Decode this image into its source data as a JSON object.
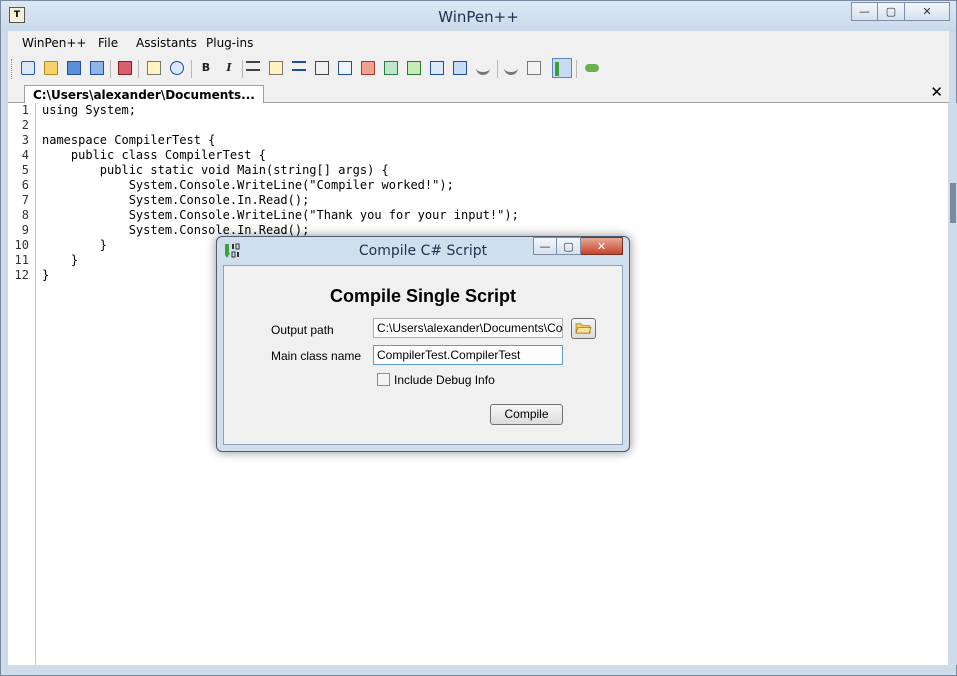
{
  "window": {
    "title": "WinPen++",
    "icon_label": "T"
  },
  "menu": {
    "items": [
      {
        "label": "WinPen++"
      },
      {
        "label": "File"
      },
      {
        "label": "Assistants"
      },
      {
        "label": "Plug-ins"
      }
    ]
  },
  "toolbar": {
    "bold_label": "B",
    "italic_label": "I"
  },
  "tabs": {
    "active_label": "C:\\Users\\alexander\\Documents...",
    "close_label": "✕"
  },
  "editor": {
    "lines": [
      {
        "num": "1",
        "text": "using System;"
      },
      {
        "num": "2",
        "text": ""
      },
      {
        "num": "3",
        "text": "namespace CompilerTest {"
      },
      {
        "num": "4",
        "text": "    public class CompilerTest {"
      },
      {
        "num": "5",
        "text": "        public static void Main(string[] args) {"
      },
      {
        "num": "6",
        "text": "            System.Console.WriteLine(\"Compiler worked!\");"
      },
      {
        "num": "7",
        "text": "            System.Console.In.Read();"
      },
      {
        "num": "8",
        "text": "            System.Console.WriteLine(\"Thank you for your input!\");"
      },
      {
        "num": "9",
        "text": "            System.Console.In.Read();"
      },
      {
        "num": "10",
        "text": "        }"
      },
      {
        "num": "11",
        "text": "    }"
      },
      {
        "num": "12",
        "text": "}"
      }
    ]
  },
  "dialog": {
    "title": "Compile C# Script",
    "heading": "Compile Single Script",
    "output_path_label": "Output path",
    "output_path_value": "C:\\Users\\alexander\\Documents\\Comp",
    "main_class_label": "Main class name",
    "main_class_value": "CompilerTest.CompilerTest",
    "debug_label": "Include Debug Info",
    "debug_checked": false,
    "compile_label": "Compile"
  }
}
